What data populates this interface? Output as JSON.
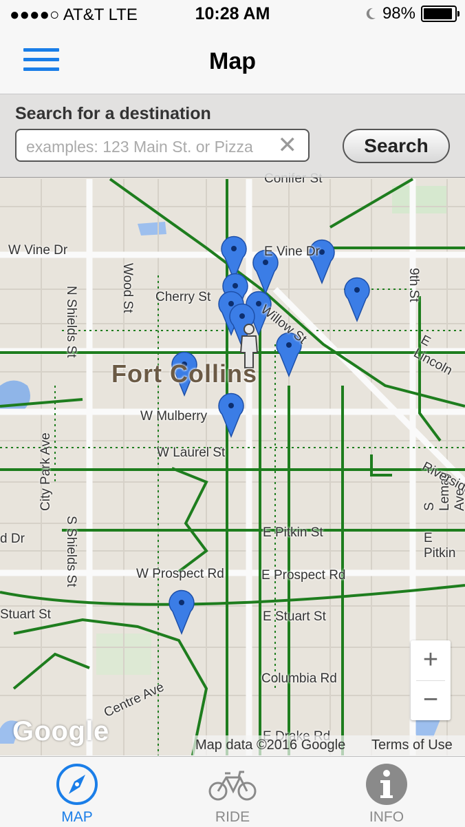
{
  "status": {
    "carrier": "●●●●○ AT&T   LTE",
    "time": "10:28 AM",
    "battery": "98%"
  },
  "nav": {
    "title": "Map"
  },
  "search": {
    "label": "Search for a destination",
    "placeholder": "examples: 123 Main St. or Pizza",
    "value": "",
    "button": "Search"
  },
  "map": {
    "city_label": "Fort Collins",
    "streets": [
      "Conifer St",
      "E Vine Dr",
      "W Vine Dr",
      "N Shields St",
      "Wood St",
      "Cherry St",
      "Willow St",
      "E Lincoln",
      "9th St",
      "W Mulberry",
      "W Laurel St",
      "City Park Ave",
      "S Shields St",
      "S Lemay Ave",
      "Riverside",
      "E Pitkin St",
      "E Pitkin",
      "W Prospect Rd",
      "E Prospect Rd",
      "Stuart St",
      "E Stuart St",
      "Columbia Rd",
      "Centre Ave",
      "E Drake Rd",
      "d Dr"
    ],
    "pins": [
      "pin",
      "pin",
      "pin",
      "pin",
      "pin",
      "pin",
      "pin",
      "pin",
      "pin",
      "pin",
      "pin",
      "pin",
      "pin"
    ],
    "zoom_in": "+",
    "zoom_out": "−",
    "logo": "Google",
    "attribution": "Map data ©2016 Google",
    "terms": "Terms of Use",
    "colors": {
      "bike_route": "#1e7d1e",
      "pin": "#3b7de6",
      "accent": "#1a7ee8"
    }
  },
  "tabs": [
    {
      "label": "MAP",
      "icon": "compass-icon",
      "active": true
    },
    {
      "label": "RIDE",
      "icon": "bicycle-icon",
      "active": false
    },
    {
      "label": "INFO",
      "icon": "info-icon",
      "active": false
    }
  ]
}
